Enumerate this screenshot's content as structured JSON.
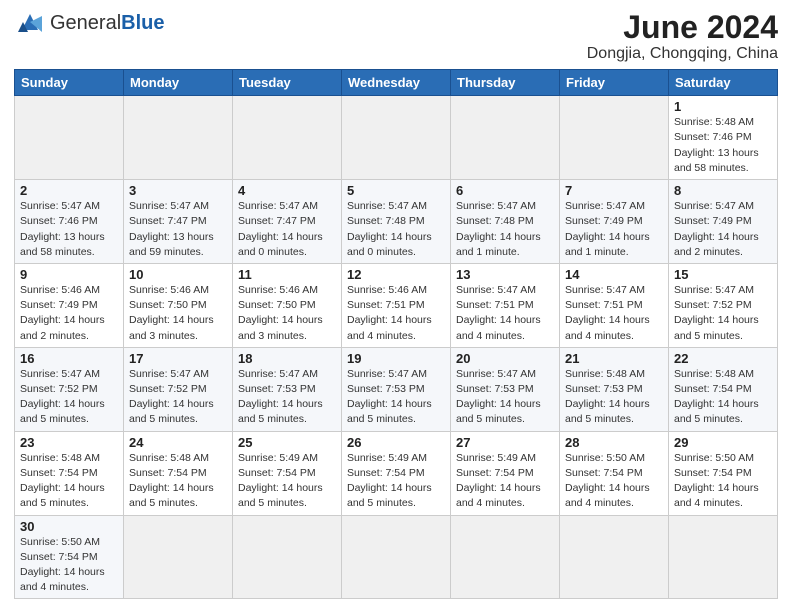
{
  "header": {
    "logo_general": "General",
    "logo_blue": "Blue",
    "month_year": "June 2024",
    "location": "Dongjia, Chongqing, China"
  },
  "weekdays": [
    "Sunday",
    "Monday",
    "Tuesday",
    "Wednesday",
    "Thursday",
    "Friday",
    "Saturday"
  ],
  "rows": [
    [
      {
        "day": "",
        "info": ""
      },
      {
        "day": "",
        "info": ""
      },
      {
        "day": "",
        "info": ""
      },
      {
        "day": "",
        "info": ""
      },
      {
        "day": "",
        "info": ""
      },
      {
        "day": "",
        "info": ""
      },
      {
        "day": "1",
        "info": "Sunrise: 5:48 AM\nSunset: 7:46 PM\nDaylight: 13 hours\nand 58 minutes."
      }
    ],
    [
      {
        "day": "2",
        "info": "Sunrise: 5:47 AM\nSunset: 7:46 PM\nDaylight: 13 hours\nand 58 minutes."
      },
      {
        "day": "3",
        "info": "Sunrise: 5:47 AM\nSunset: 7:47 PM\nDaylight: 13 hours\nand 59 minutes."
      },
      {
        "day": "4",
        "info": "Sunrise: 5:47 AM\nSunset: 7:47 PM\nDaylight: 14 hours\nand 0 minutes."
      },
      {
        "day": "5",
        "info": "Sunrise: 5:47 AM\nSunset: 7:48 PM\nDaylight: 14 hours\nand 0 minutes."
      },
      {
        "day": "6",
        "info": "Sunrise: 5:47 AM\nSunset: 7:48 PM\nDaylight: 14 hours\nand 1 minute."
      },
      {
        "day": "7",
        "info": "Sunrise: 5:47 AM\nSunset: 7:49 PM\nDaylight: 14 hours\nand 1 minute."
      },
      {
        "day": "8",
        "info": "Sunrise: 5:47 AM\nSunset: 7:49 PM\nDaylight: 14 hours\nand 2 minutes."
      }
    ],
    [
      {
        "day": "9",
        "info": "Sunrise: 5:46 AM\nSunset: 7:49 PM\nDaylight: 14 hours\nand 2 minutes."
      },
      {
        "day": "10",
        "info": "Sunrise: 5:46 AM\nSunset: 7:50 PM\nDaylight: 14 hours\nand 3 minutes."
      },
      {
        "day": "11",
        "info": "Sunrise: 5:46 AM\nSunset: 7:50 PM\nDaylight: 14 hours\nand 3 minutes."
      },
      {
        "day": "12",
        "info": "Sunrise: 5:46 AM\nSunset: 7:51 PM\nDaylight: 14 hours\nand 4 minutes."
      },
      {
        "day": "13",
        "info": "Sunrise: 5:47 AM\nSunset: 7:51 PM\nDaylight: 14 hours\nand 4 minutes."
      },
      {
        "day": "14",
        "info": "Sunrise: 5:47 AM\nSunset: 7:51 PM\nDaylight: 14 hours\nand 4 minutes."
      },
      {
        "day": "15",
        "info": "Sunrise: 5:47 AM\nSunset: 7:52 PM\nDaylight: 14 hours\nand 5 minutes."
      }
    ],
    [
      {
        "day": "16",
        "info": "Sunrise: 5:47 AM\nSunset: 7:52 PM\nDaylight: 14 hours\nand 5 minutes."
      },
      {
        "day": "17",
        "info": "Sunrise: 5:47 AM\nSunset: 7:52 PM\nDaylight: 14 hours\nand 5 minutes."
      },
      {
        "day": "18",
        "info": "Sunrise: 5:47 AM\nSunset: 7:53 PM\nDaylight: 14 hours\nand 5 minutes."
      },
      {
        "day": "19",
        "info": "Sunrise: 5:47 AM\nSunset: 7:53 PM\nDaylight: 14 hours\nand 5 minutes."
      },
      {
        "day": "20",
        "info": "Sunrise: 5:47 AM\nSunset: 7:53 PM\nDaylight: 14 hours\nand 5 minutes."
      },
      {
        "day": "21",
        "info": "Sunrise: 5:48 AM\nSunset: 7:53 PM\nDaylight: 14 hours\nand 5 minutes."
      },
      {
        "day": "22",
        "info": "Sunrise: 5:48 AM\nSunset: 7:54 PM\nDaylight: 14 hours\nand 5 minutes."
      }
    ],
    [
      {
        "day": "23",
        "info": "Sunrise: 5:48 AM\nSunset: 7:54 PM\nDaylight: 14 hours\nand 5 minutes."
      },
      {
        "day": "24",
        "info": "Sunrise: 5:48 AM\nSunset: 7:54 PM\nDaylight: 14 hours\nand 5 minutes."
      },
      {
        "day": "25",
        "info": "Sunrise: 5:49 AM\nSunset: 7:54 PM\nDaylight: 14 hours\nand 5 minutes."
      },
      {
        "day": "26",
        "info": "Sunrise: 5:49 AM\nSunset: 7:54 PM\nDaylight: 14 hours\nand 5 minutes."
      },
      {
        "day": "27",
        "info": "Sunrise: 5:49 AM\nSunset: 7:54 PM\nDaylight: 14 hours\nand 4 minutes."
      },
      {
        "day": "28",
        "info": "Sunrise: 5:50 AM\nSunset: 7:54 PM\nDaylight: 14 hours\nand 4 minutes."
      },
      {
        "day": "29",
        "info": "Sunrise: 5:50 AM\nSunset: 7:54 PM\nDaylight: 14 hours\nand 4 minutes."
      }
    ],
    [
      {
        "day": "30",
        "info": "Sunrise: 5:50 AM\nSunset: 7:54 PM\nDaylight: 14 hours\nand 4 minutes."
      },
      {
        "day": "",
        "info": ""
      },
      {
        "day": "",
        "info": ""
      },
      {
        "day": "",
        "info": ""
      },
      {
        "day": "",
        "info": ""
      },
      {
        "day": "",
        "info": ""
      },
      {
        "day": "",
        "info": ""
      }
    ]
  ]
}
